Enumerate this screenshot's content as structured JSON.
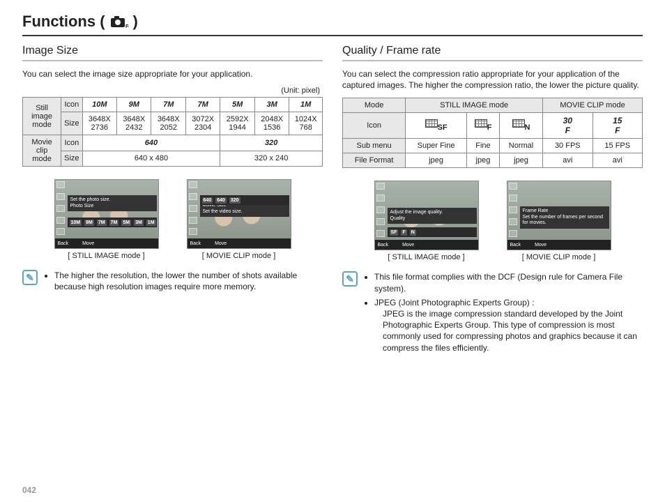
{
  "page_number": "042",
  "title_prefix": "Functions (",
  "title_suffix": ")",
  "left": {
    "heading": "Image Size",
    "intro": "You can select the image size appropriate for your application.",
    "unit": "(Unit: pixel)",
    "table": {
      "still_label": "Still image mode",
      "movie_label": "Movie clip mode",
      "icon_label": "Icon",
      "size_label": "Size",
      "still_icons": [
        "10M",
        "9M",
        "7M",
        "7M",
        "5M",
        "3M",
        "1M"
      ],
      "still_sizes": [
        "3648X 2736",
        "3648X 2432",
        "3648X 2052",
        "3072X 2304",
        "2592X 1944",
        "2048X 1536",
        "1024X 768"
      ],
      "movie_icons": [
        "640",
        "320"
      ],
      "movie_sizes": [
        "640 x 480",
        "320 x 240"
      ]
    },
    "shot1": {
      "help_line1": "Set the photo size.",
      "help_line2": "Photo Size",
      "strip": [
        "10M",
        "9M",
        "7M",
        "7M",
        "5M",
        "3M",
        "1M"
      ],
      "back": "Back",
      "move": "Move",
      "caption": "[ STILL IMAGE mode ]"
    },
    "shot2": {
      "help_line1": "Movie Size",
      "help_line2": "Set the video size.",
      "strip": [
        "640",
        "640",
        "320"
      ],
      "back": "Back",
      "move": "Move",
      "caption": "[ MOVIE CLIP mode ]"
    },
    "note": "The higher the resolution, the lower the number of shots available because high resolution images require more memory."
  },
  "right": {
    "heading": "Quality / Frame rate",
    "intro": "You can select the compression ratio appropriate for your application of the captured images. The higher the compression ratio, the lower the picture quality.",
    "table": {
      "mode": "Mode",
      "still_mode": "STILL IMAGE mode",
      "movie_mode": "MOVIE CLIP mode",
      "icon": "Icon",
      "submenu_label": "Sub menu",
      "submenu": [
        "Super Fine",
        "Fine",
        "Normal",
        "30 FPS",
        "15 FPS"
      ],
      "file_format_label": "File Format",
      "file_format": [
        "jpeg",
        "jpeg",
        "jpeg",
        "avi",
        "avi"
      ],
      "quality_icons": [
        "SF",
        "F",
        "N"
      ],
      "fps_icons": [
        "30",
        "15"
      ]
    },
    "shot1": {
      "help_line1": "Adjust the image quality.",
      "help_line2": "Quality",
      "back": "Back",
      "move": "Move",
      "caption": "[ STILL IMAGE mode ]"
    },
    "shot2": {
      "help_line1": "Frame Rate",
      "help_line2": "Set the number of frames per second for movies.",
      "back": "Back",
      "move": "Move",
      "caption": "[ MOVIE CLIP mode ]"
    },
    "notes": [
      "This file format complies with the DCF (Design rule for Camera File system).",
      "JPEG (Joint Photographic Experts Group) :",
      "JPEG is the image compression standard developed by the Joint Photographic Experts Group. This type of compression is most commonly used for compressing photos and graphics because it can compress the files efficiently."
    ]
  }
}
